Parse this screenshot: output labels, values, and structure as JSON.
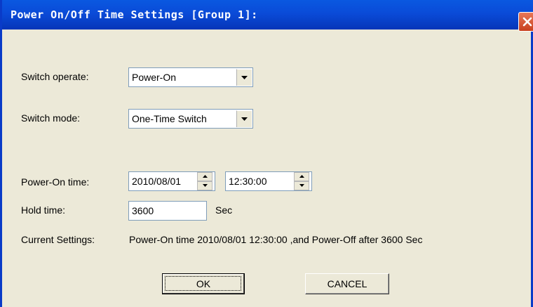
{
  "window": {
    "title": "Power On/Off Time Settings [Group 1]:"
  },
  "switch_operate": {
    "label": "Switch operate:",
    "value": "Power-On"
  },
  "switch_mode": {
    "label": "Switch  mode:",
    "value": "One-Time Switch"
  },
  "power_on_time": {
    "label": "Power-On time:",
    "date": "2010/08/01",
    "time": "12:30:00"
  },
  "hold_time": {
    "label": "Hold time:",
    "value": "3600",
    "unit": "Sec"
  },
  "current_settings": {
    "label": "Current Settings:",
    "text": "Power-On time 2010/08/01 12:30:00 ,and Power-Off after 3600 Sec"
  },
  "buttons": {
    "ok": "OK",
    "cancel": "CANCEL"
  },
  "icons": {
    "close": "close-icon",
    "dropdown": "chevron-down-icon",
    "spin_up": "spin-up-icon",
    "spin_down": "spin-down-icon"
  },
  "colors": {
    "titlebar": "#0A4BD8",
    "dialog_bg": "#ECE9D8",
    "close": "#D0502C"
  }
}
